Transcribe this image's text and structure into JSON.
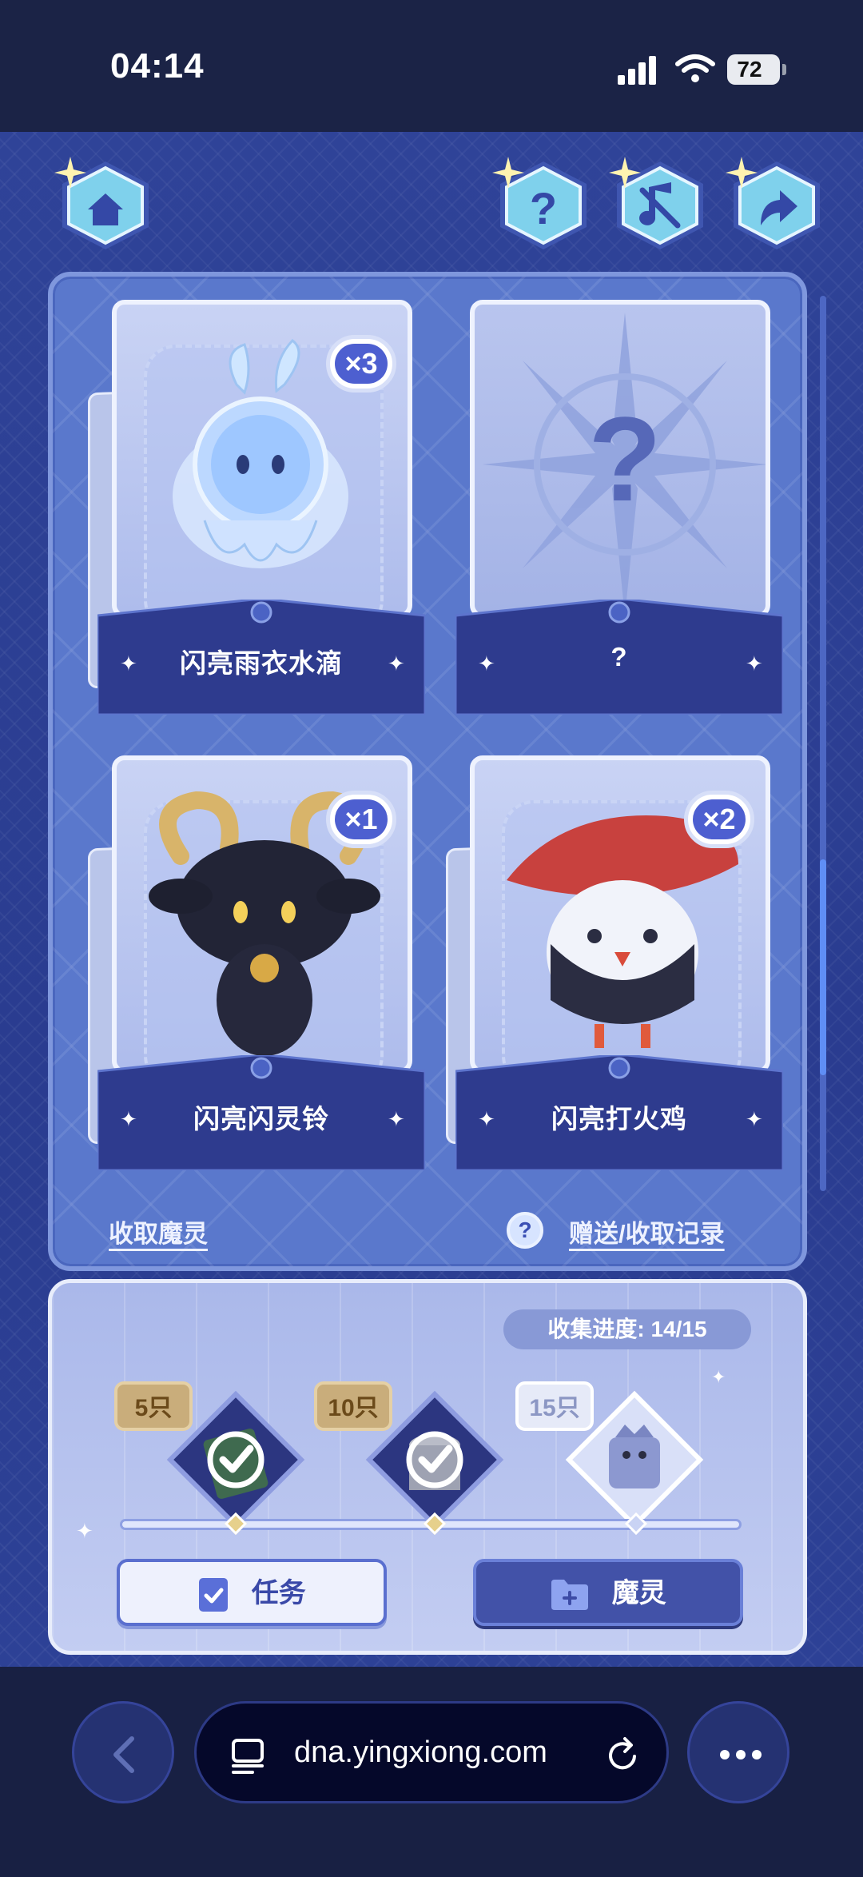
{
  "status": {
    "time": "04:14",
    "battery": "72"
  },
  "cards": [
    {
      "name": "闪亮雨衣水滴",
      "count": "×3"
    },
    {
      "name": "?",
      "count": ""
    },
    {
      "name": "闪亮闪灵铃",
      "count": "×1"
    },
    {
      "name": "闪亮打火鸡",
      "count": "×2"
    }
  ],
  "links": {
    "receive": "收取魔灵",
    "help": "?",
    "records": "赠送/收取记录"
  },
  "progress": {
    "label": "收集进度: 14/15",
    "value": 14,
    "total": 15
  },
  "milestones": [
    {
      "label": "5只",
      "done": true
    },
    {
      "label": "10只",
      "done": true
    },
    {
      "label": "15只",
      "done": false
    }
  ],
  "buttons": {
    "task": "任务",
    "pet": "魔灵"
  },
  "browser": {
    "url": "dna.yingxiong.com"
  },
  "colors": {
    "accent": "#4d5fd0",
    "panel": "#5a78cc",
    "background": "#2c3f93"
  }
}
